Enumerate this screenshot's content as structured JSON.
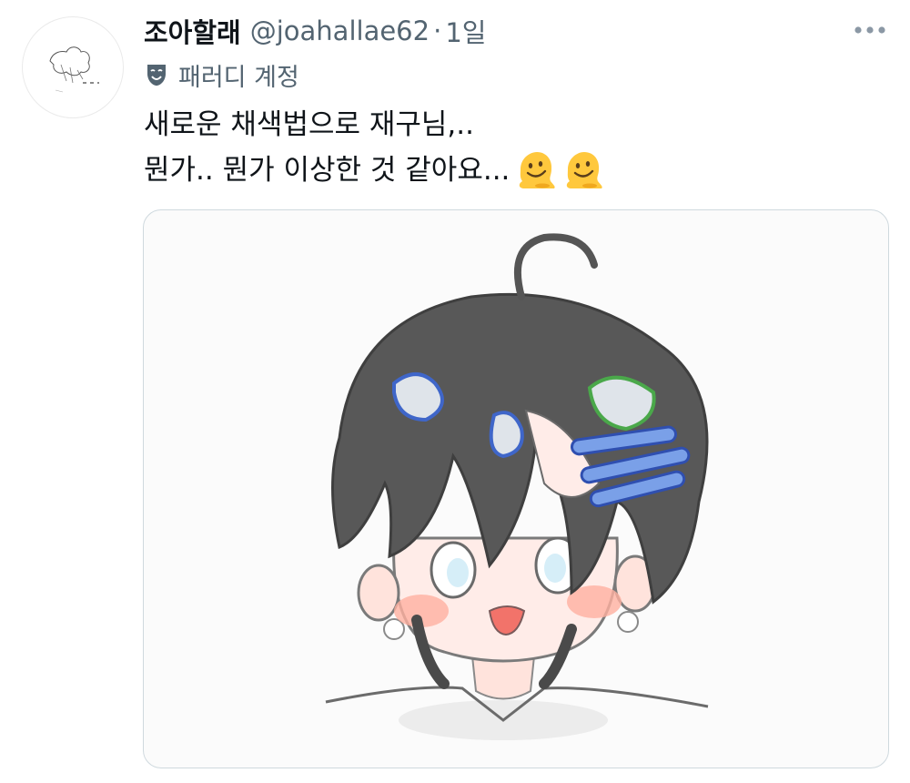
{
  "tweet": {
    "display_name": "조아할래",
    "handle": "@joahallae62",
    "separator": "·",
    "time": "1일",
    "account_label": "패러디 계정",
    "text_line1": "새로운 채색법으로 재구님,..",
    "text_line2": "뭔가.. 뭔가 이상한 것 같아요...",
    "emojis": [
      "melting-face",
      "melting-face"
    ]
  },
  "icons": {
    "more": "more-horizontal-icon",
    "parody": "theater-mask-icon"
  },
  "colors": {
    "text_primary": "#0f1419",
    "text_secondary": "#536471",
    "border": "#cfd9de"
  }
}
